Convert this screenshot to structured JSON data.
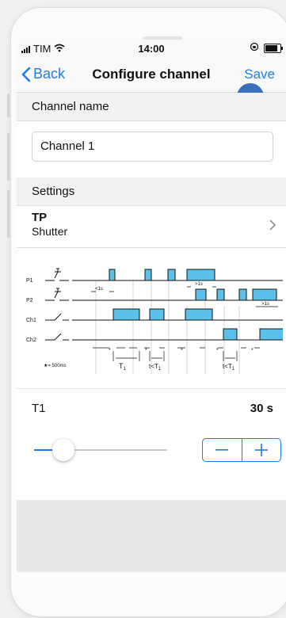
{
  "status": {
    "carrier": "TIM",
    "time": "14:00"
  },
  "nav": {
    "back_label": "Back",
    "title": "Configure channel",
    "save_label": "Save"
  },
  "channel": {
    "section_label": "Channel name",
    "name_value": "Channel 1"
  },
  "settings": {
    "section_label": "Settings",
    "mode_title": "TP",
    "mode_subtitle": "Shutter"
  },
  "diagram": {
    "rows": [
      "P1",
      "P2",
      "Ch1",
      "Ch2"
    ],
    "annotations": {
      "lt1s": "<1s",
      "gt1s_a": ">1s",
      "gt1s_b": ">1s",
      "star_note": "★= 500ms",
      "t1": "T",
      "t1_sub": "1",
      "t_lt": "t<T",
      "t_lt_sub": "1"
    }
  },
  "t1": {
    "label": "T1",
    "value": "30 s",
    "slider_fraction": 0.22
  },
  "colors": {
    "accent": "#1f7de6",
    "pulse": "#5bc0ea"
  }
}
